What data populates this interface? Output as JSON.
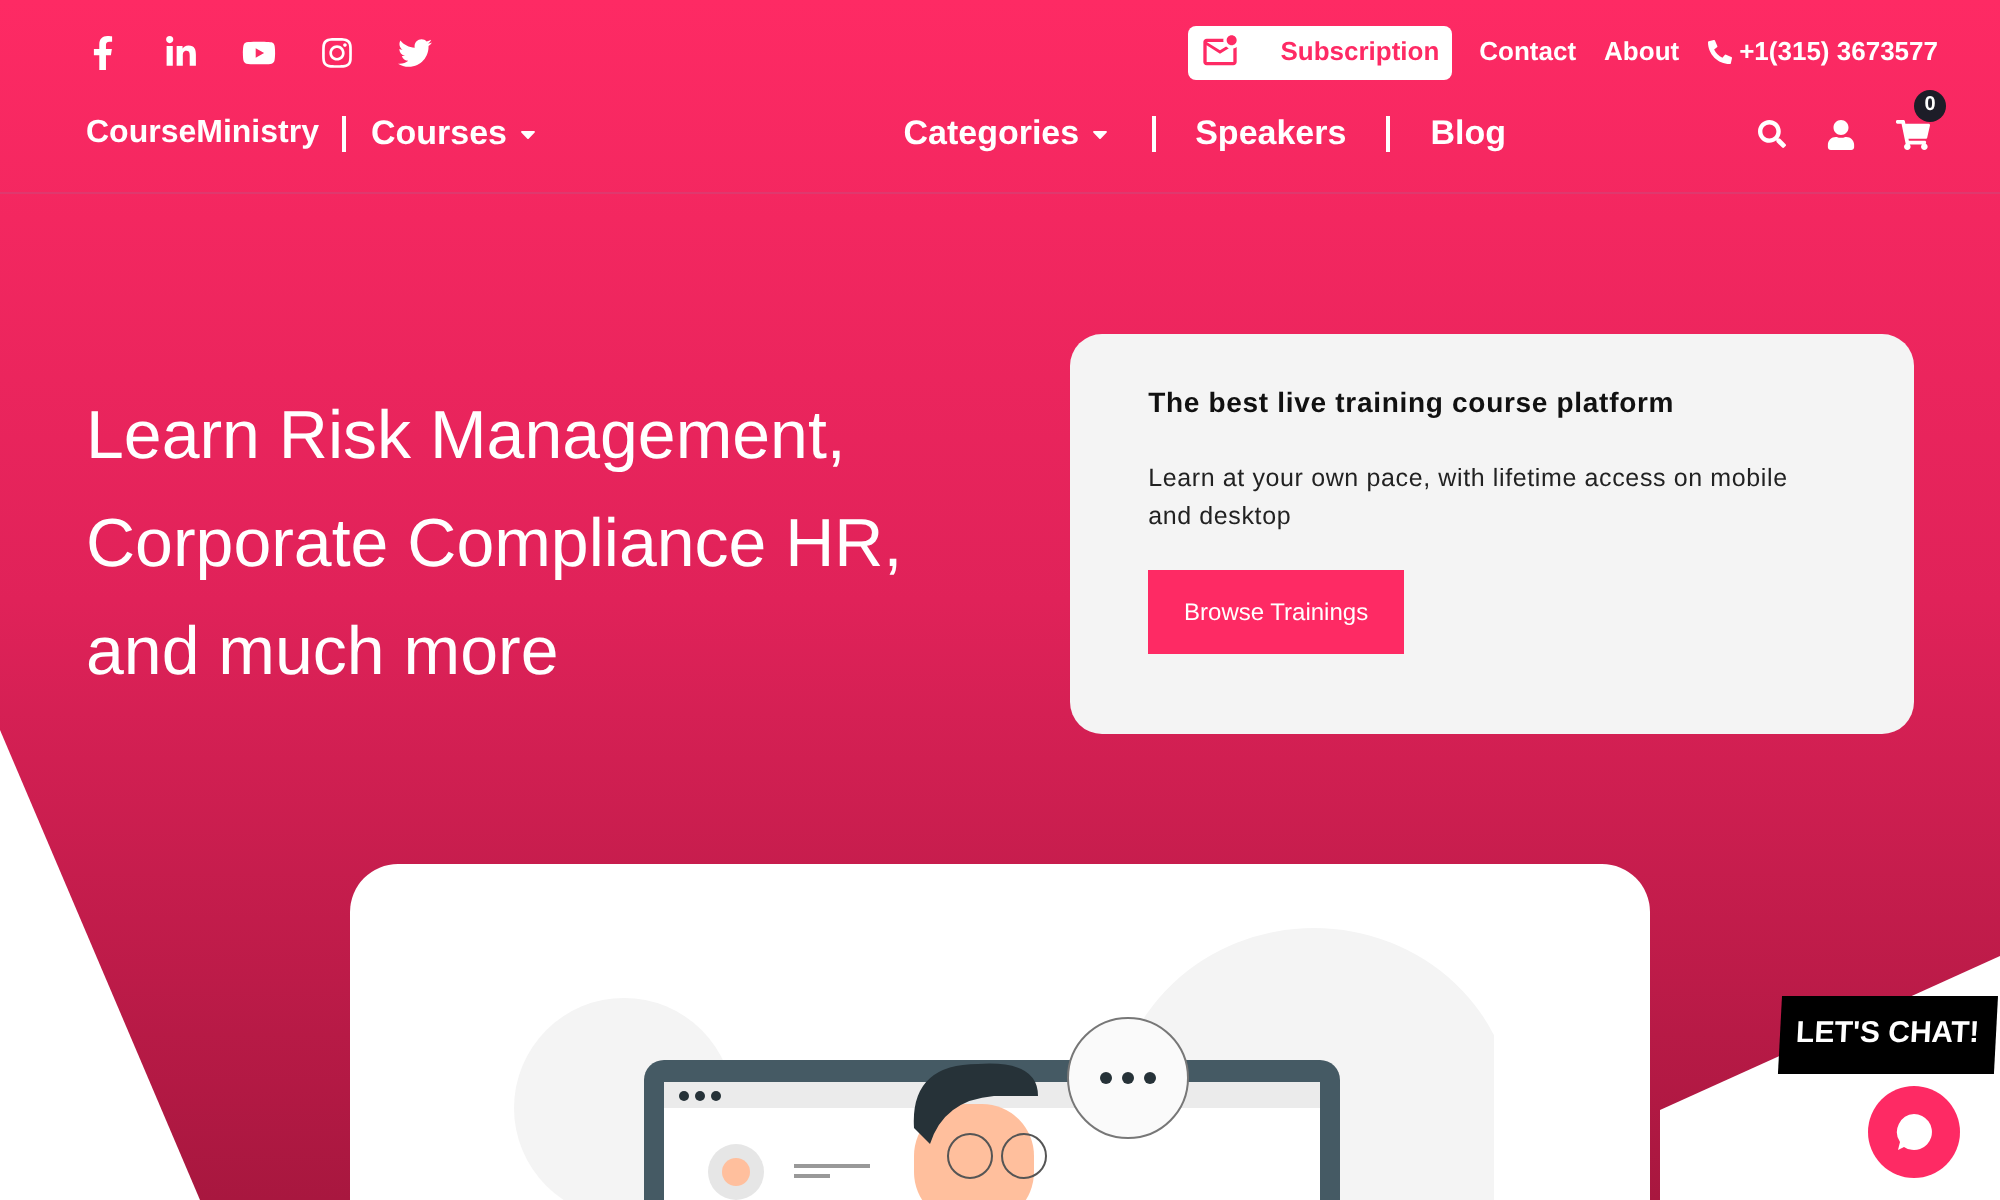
{
  "top_bar": {
    "subscription": "Subscription",
    "links": [
      "Contact",
      "About"
    ],
    "phone": "+1(315) 3673577"
  },
  "nav": {
    "brand": "CourseMinistry",
    "left": [
      {
        "label": "Courses",
        "dropdown": true
      }
    ],
    "right": [
      {
        "label": "Categories",
        "dropdown": true
      },
      {
        "label": "Speakers",
        "dropdown": false
      },
      {
        "label": "Blog",
        "dropdown": false
      }
    ],
    "cart_count": "0"
  },
  "hero": {
    "headline_lines": [
      "Learn Risk Management,",
      "Corporate Compliance HR,",
      "and much more"
    ]
  },
  "card": {
    "title": "The best live training course platform",
    "text": "Learn at your own pace, with lifetime access on mobile and desktop",
    "button": "Browse Trainings"
  },
  "chat": {
    "label": "LET'S CHAT!"
  }
}
